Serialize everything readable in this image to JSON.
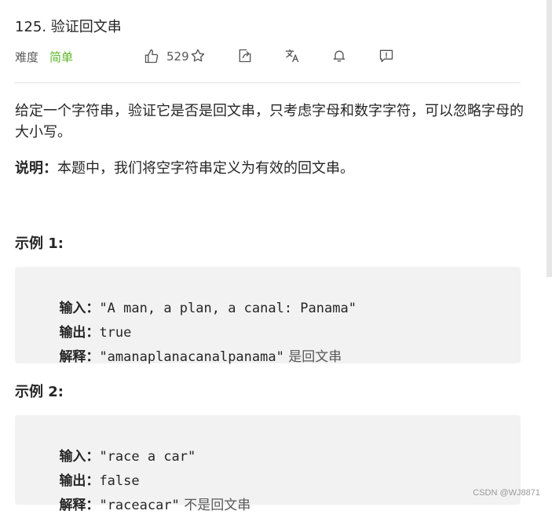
{
  "problem": {
    "title": "125. 验证回文串",
    "difficulty_label": "难度",
    "difficulty": "简单",
    "likes": "529"
  },
  "toolbar": {
    "icons": [
      "thumbs-up-icon",
      "star-icon",
      "share-icon",
      "translate-icon",
      "bell-icon",
      "feedback-icon"
    ]
  },
  "description": {
    "text": "给定一个字符串，验证它是否是回文串，只考虑字母和数字字符，可以忽略字母的大小写。",
    "note_label": "说明：",
    "note_text": "本题中，我们将空字符串定义为有效的回文串。"
  },
  "examples": [
    {
      "title": "示例 1:",
      "input_label": "输入：",
      "input": "\"A man, a plan, a canal: Panama\"",
      "output_label": "输出：",
      "output": "true",
      "explain_label": "解释：",
      "explain_value": "\"amanaplanacanalpanama\"",
      "explain_text": "是回文串"
    },
    {
      "title": "示例 2:",
      "input_label": "输入：",
      "input": "\"race a car\"",
      "output_label": "输出：",
      "output": "false",
      "explain_label": "解释：",
      "explain_value": "\"raceacar\"",
      "explain_text": "不是回文串"
    }
  ],
  "watermark": "CSDN @WJ8871",
  "colors": {
    "easy": "#5ab726",
    "code_bg": "#f2f2f2"
  }
}
